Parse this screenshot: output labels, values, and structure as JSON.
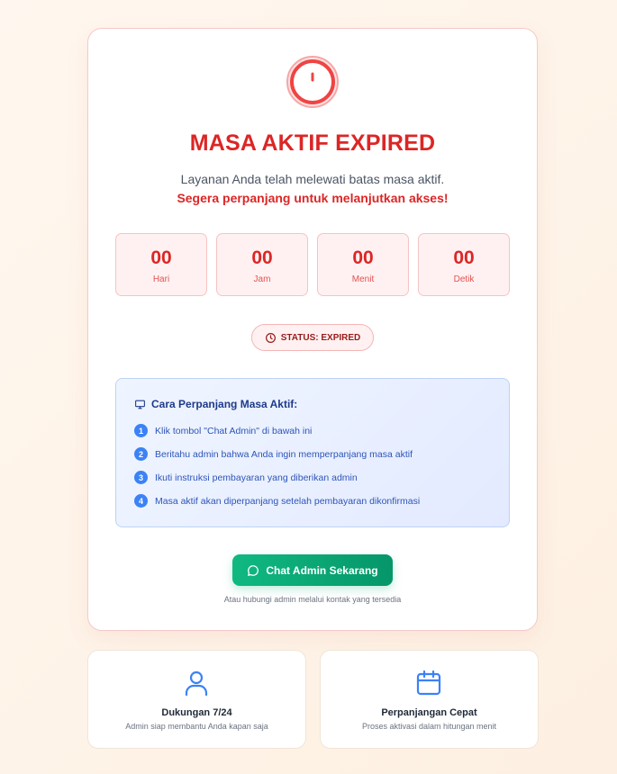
{
  "alert": {
    "icon": "alert-circle-icon",
    "title": "MASA AKTIF EXPIRED",
    "description": "Layanan Anda telah melewati batas masa aktif.",
    "warning": "Segera perpanjang untuk melanjutkan akses!"
  },
  "countdown": [
    {
      "value": "00",
      "label": "Hari"
    },
    {
      "value": "00",
      "label": "Jam"
    },
    {
      "value": "00",
      "label": "Menit"
    },
    {
      "value": "00",
      "label": "Detik"
    }
  ],
  "status": {
    "icon": "clock-icon",
    "text": "STATUS: EXPIRED"
  },
  "guide": {
    "icon": "monitor-icon",
    "title": "Cara Perpanjang Masa Aktif:",
    "steps": [
      {
        "num": "1",
        "text": "Klik tombol \"Chat Admin\" di bawah ini"
      },
      {
        "num": "2",
        "text": "Beritahu admin bahwa Anda ingin memperpanjang masa aktif"
      },
      {
        "num": "3",
        "text": "Ikuti instruksi pembayaran yang diberikan admin"
      },
      {
        "num": "4",
        "text": "Masa aktif akan diperpanjang setelah pembayaran dikonfirmasi"
      }
    ]
  },
  "cta": {
    "icon": "chat-bubble-icon",
    "label": "Chat Admin Sekarang",
    "note": "Atau hubungi admin melalui kontak yang tersedia"
  },
  "features": [
    {
      "icon": "user-icon",
      "title": "Dukungan 7/24",
      "desc": "Admin siap membantu Anda kapan saja"
    },
    {
      "icon": "calendar-icon",
      "title": "Perpanjangan Cepat",
      "desc": "Proses aktivasi dalam hitungan menit"
    }
  ],
  "colors": {
    "danger": "#dc2626",
    "info": "#3b82f6",
    "success": "#10b981",
    "background": "#fdf3e7"
  }
}
